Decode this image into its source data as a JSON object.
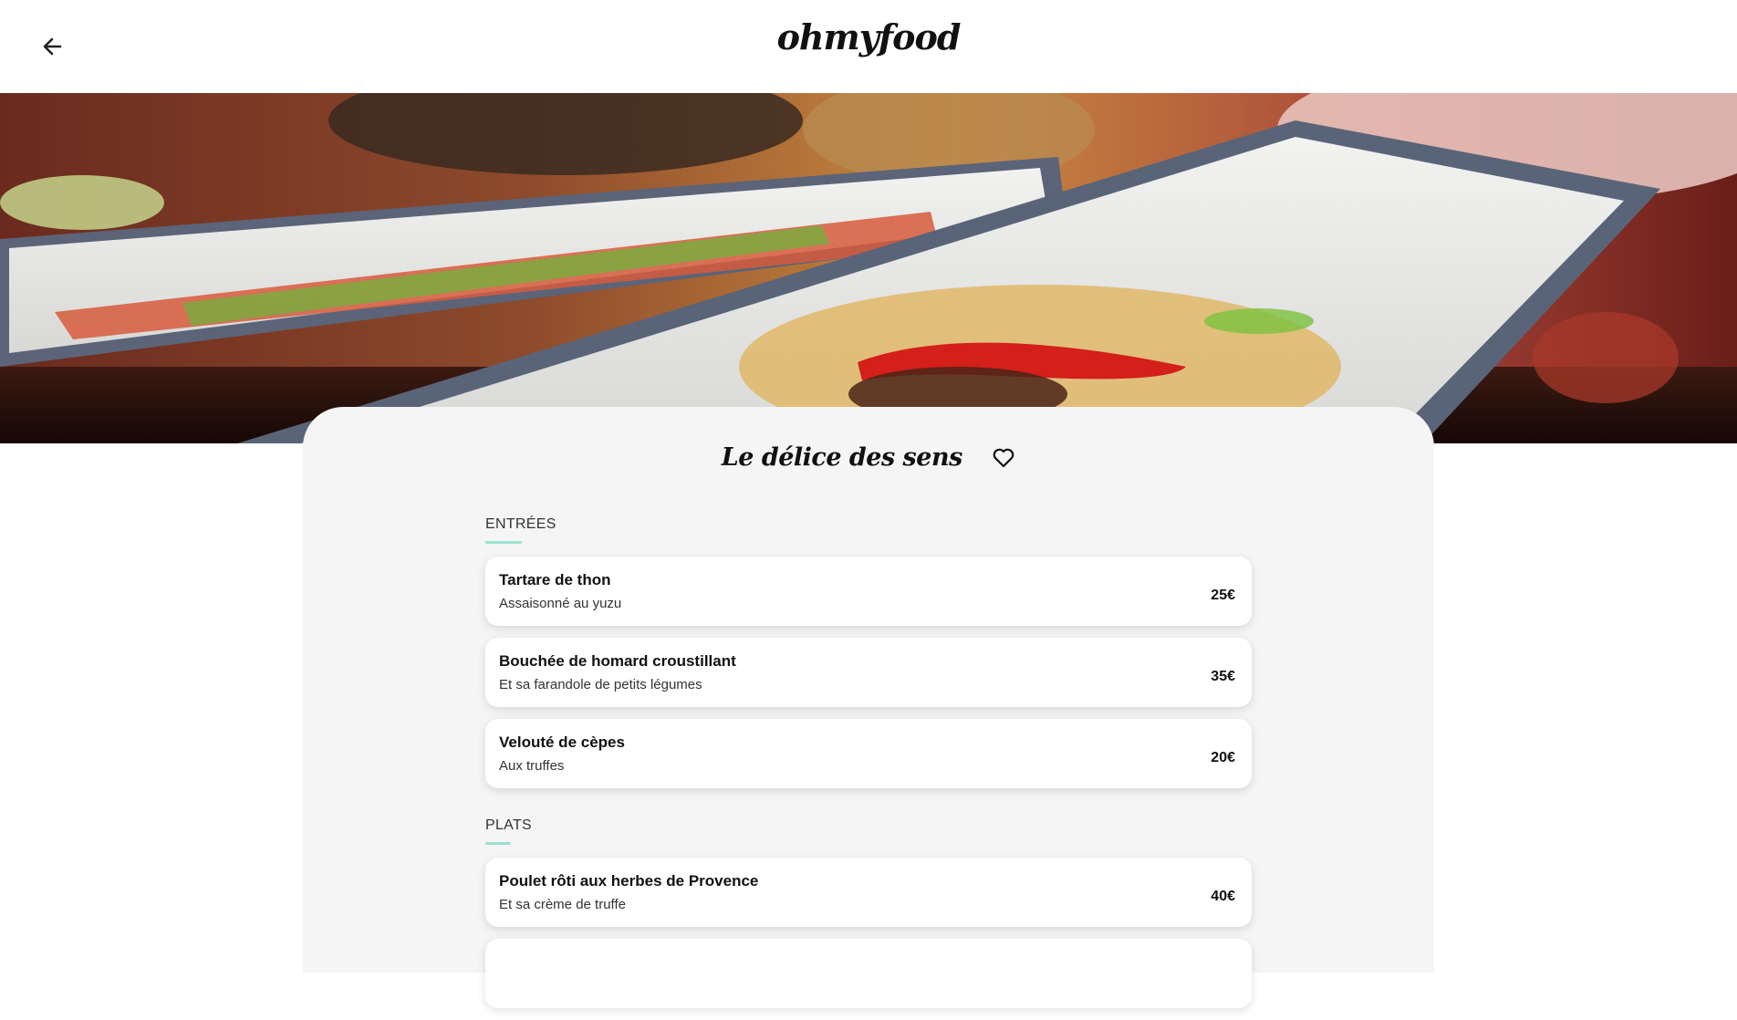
{
  "header": {
    "back_icon": "arrow-left-icon",
    "logo": "ohmyfood"
  },
  "hero": {
    "image": "asian-fish-dishes-photo"
  },
  "restaurant": {
    "name": "Le délice des sens",
    "favorite_icon": "heart-outline-icon"
  },
  "sections": [
    {
      "title": "ENTRÉES",
      "dishes": [
        {
          "name": "Tartare de thon",
          "description": "Assaisonné au yuzu",
          "price": "25€"
        },
        {
          "name": "Bouchée de homard croustillant",
          "description": "Et sa farandole de petits légumes",
          "price": "35€"
        },
        {
          "name": "Velouté de cèpes",
          "description": "Aux truffes",
          "price": "20€"
        }
      ]
    },
    {
      "title": "PLATS",
      "dishes": [
        {
          "name": "Poulet rôti aux herbes de Provence",
          "description": "Et sa crème de truffe",
          "price": "40€"
        }
      ]
    }
  ],
  "colors": {
    "accent": "#99e2d0",
    "card_background": "#f5f5f5"
  }
}
